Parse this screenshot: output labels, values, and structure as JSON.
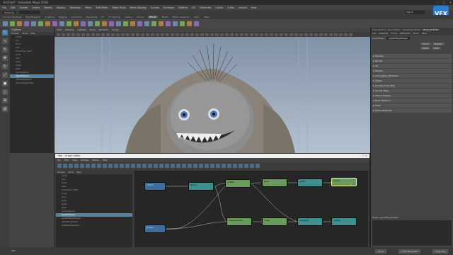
{
  "window": {
    "title": "Untitled* - Autodesk Maya 2018"
  },
  "menus": [
    "File",
    "Edit",
    "Create",
    "Select",
    "Modify",
    "Display",
    "Windows",
    "Mesh",
    "Edit Mesh",
    "Mesh Tools",
    "Mesh Display",
    "Curves",
    "Surfaces",
    "Deform",
    "UV",
    "Generate",
    "Cache",
    "V-Ray",
    "Arnold",
    "Help"
  ],
  "status": {
    "workspace": "Modeling",
    "search_hint": "",
    "login": "Sign In"
  },
  "shelf_tabs": [
    "Curves / Surfaces",
    "Poly Modeling",
    "Sculpting",
    "Rigging",
    "Animation",
    "Rendering",
    "FX",
    "FX Caching",
    "Custom",
    "Arnold",
    "Bifrost",
    "MASH",
    "Motion Graphics",
    "XGen",
    "VRay"
  ],
  "shelf_active_index": 10,
  "brand": "VFX",
  "outliner": {
    "title": "Outliner",
    "menu": [
      "Display",
      "Show",
      "Help"
    ],
    "items": [
      "persp",
      "top",
      "front",
      "side",
      "Character_GRP",
      "body",
      "hair",
      "eyes",
      "teeth",
      "light",
      "hairSystem1",
      "pgYetiMaya1",
      "defaultLightSet",
      "defaultObjectSet"
    ],
    "selected_index": 11
  },
  "viewport": {
    "menu": [
      "View",
      "Shading",
      "Lighting",
      "Show",
      "Renderer",
      "Panels"
    ]
  },
  "attribute_editor": {
    "tabs": [
      "Channel Box / Layer Editor",
      "Modelling Toolkit",
      "Attribute Editor"
    ],
    "menu": [
      "List",
      "Selected",
      "Focus",
      "Attributes",
      "Show",
      "Help"
    ],
    "node_label": "pgYetiMaya:",
    "node_value": "pgYetiMayaShape",
    "buttons": [
      "Focus",
      "Presets",
      "Show",
      "Hide"
    ],
    "sections": [
      "Preview",
      "Render",
      "I/O",
      "Display",
      "Cumulative Attributes",
      "Shape",
      "Displacement Map",
      "Render Stats",
      "Object Display",
      "Node Behavior",
      "UUID",
      "Extra Attributes"
    ],
    "notes_label": "Notes: pgYetiMayaShape"
  },
  "graph_editor": {
    "title": "Yeti - Graph Editor",
    "menu": [
      "File",
      "Edit",
      "View",
      "Utilities",
      "Nodes",
      "Help"
    ],
    "left_menu": [
      "Display",
      "Show",
      "Help"
    ],
    "tree": [
      "persp",
      "top",
      "front",
      "side",
      "Character_GRP",
      "body",
      "hair",
      "eyes",
      "teeth",
      "light",
      "hairSystem1",
      "pgYetiMaya1",
      "pgYetiMayaShape",
      "defaultLightSet",
      "defaultObjectSet"
    ],
    "tree_selected_index": 11,
    "nodes": [
      {
        "label": "import",
        "kind": "blue"
      },
      {
        "label": "groom",
        "kind": "teal"
      },
      {
        "label": "scatter",
        "kind": "green"
      },
      {
        "label": "grow",
        "kind": "green"
      },
      {
        "label": "width",
        "kind": "teal"
      },
      {
        "label": "clump",
        "kind": "green"
      },
      {
        "label": "guides",
        "kind": "blue"
      },
      {
        "label": "displacement",
        "kind": "green"
      },
      {
        "label": "noise",
        "kind": "green"
      },
      {
        "label": "scraggle",
        "kind": "teal"
      },
      {
        "label": "output",
        "kind": "teal"
      }
    ],
    "status": "Yeti Graph: pgYetiMaya  Nodes: 11"
  },
  "help_buttons": [
    "Show",
    "Load Attributes",
    "Copy Tab"
  ],
  "command_line": "MEL"
}
